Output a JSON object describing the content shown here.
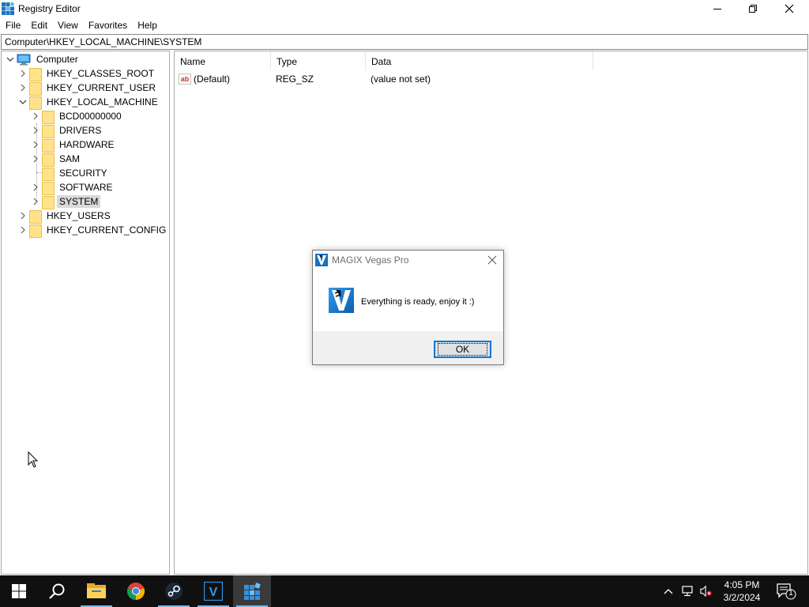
{
  "window": {
    "title": "Registry Editor",
    "controls": [
      "minimize",
      "restore",
      "close"
    ]
  },
  "menu": [
    "File",
    "Edit",
    "View",
    "Favorites",
    "Help"
  ],
  "address": "Computer\\HKEY_LOCAL_MACHINE\\SYSTEM",
  "tree": {
    "root": "Computer",
    "hives": [
      {
        "label": "HKEY_CLASSES_ROOT",
        "expanded": false
      },
      {
        "label": "HKEY_CURRENT_USER",
        "expanded": false
      },
      {
        "label": "HKEY_LOCAL_MACHINE",
        "expanded": true
      },
      {
        "label": "HKEY_USERS",
        "expanded": false
      },
      {
        "label": "HKEY_CURRENT_CONFIG",
        "expanded": false
      }
    ],
    "hklm_children": [
      {
        "label": "BCD00000000",
        "has_children": true
      },
      {
        "label": "DRIVERS",
        "has_children": true
      },
      {
        "label": "HARDWARE",
        "has_children": true
      },
      {
        "label": "SAM",
        "has_children": true
      },
      {
        "label": "SECURITY",
        "has_children": false
      },
      {
        "label": "SOFTWARE",
        "has_children": true
      },
      {
        "label": "SYSTEM",
        "has_children": true,
        "selected": true
      }
    ]
  },
  "list": {
    "columns": [
      "Name",
      "Type",
      "Data"
    ],
    "rows": [
      {
        "name": "(Default)",
        "type": "REG_SZ",
        "data": "(value not set)",
        "icon": "ab-string-icon"
      }
    ]
  },
  "dialog": {
    "title": "MAGIX Vegas Pro",
    "message": "Everything is ready, enjoy it :)",
    "ok_label": "OK"
  },
  "taskbar": {
    "apps": [
      "start",
      "search",
      "file-explorer",
      "chrome",
      "steam",
      "vegas",
      "registry-editor"
    ],
    "active_app": "registry-editor",
    "time": "4:05 PM",
    "date": "3/2/2024",
    "notification_count": "1",
    "accent_color": "#76b9ed"
  }
}
